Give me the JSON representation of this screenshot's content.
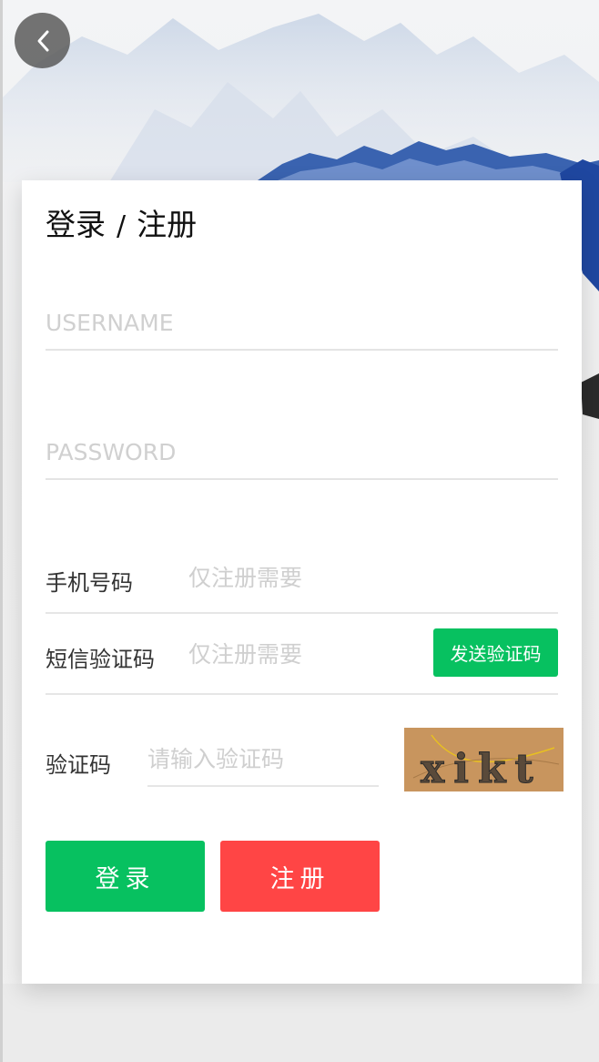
{
  "header": {
    "back_icon": "chevron-left-icon"
  },
  "form": {
    "title_login": "登录",
    "title_sep": "/",
    "title_register": "注册",
    "username_placeholder": "USERNAME",
    "password_placeholder": "PASSWORD",
    "phone_label": "手机号码",
    "phone_placeholder": "仅注册需要",
    "sms_label": "短信验证码",
    "sms_placeholder": "仅注册需要",
    "send_code_label": "发送验证码",
    "captcha_label": "验证码",
    "captcha_placeholder": "请输入验证码",
    "captcha_text": "xikt",
    "login_label": "登录",
    "register_label": "注册"
  },
  "colors": {
    "primary_green": "#07c160",
    "register_red": "#ff4545",
    "captcha_bg": "#c8955e"
  }
}
